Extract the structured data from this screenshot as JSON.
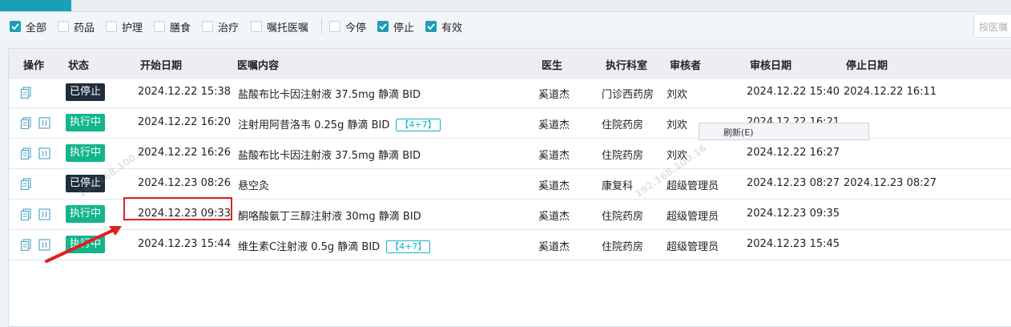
{
  "filters": [
    {
      "label": "全部",
      "checked": true
    },
    {
      "label": "药品",
      "checked": false
    },
    {
      "label": "护理",
      "checked": false
    },
    {
      "label": "膳食",
      "checked": false
    },
    {
      "label": "治疗",
      "checked": false
    },
    {
      "label": "嘱托医嘱",
      "checked": false
    },
    {
      "label": "今停",
      "checked": false
    },
    {
      "label": "停止",
      "checked": true
    },
    {
      "label": "有效",
      "checked": true
    }
  ],
  "search": {
    "placeholder": "按医嘱"
  },
  "columns": {
    "ops": "操作",
    "status": "状态",
    "start": "开始日期",
    "content": "医嘱内容",
    "doctor": "医生",
    "dept": "执行科室",
    "reviewer": "审核者",
    "review_date": "审核日期",
    "stop_date": "停止日期"
  },
  "rows": [
    {
      "status": "已停止",
      "start": "2024.12.22 15:38",
      "content": "盐酸布比卡因注射液 37.5mg 静滴 BID",
      "tag": "",
      "doctor": "奚道杰",
      "dept": "门诊西药房",
      "reviewer": "刘欢",
      "review_date": "2024.12.22 15:40",
      "stop_date": "2024.12.22 16:11"
    },
    {
      "status": "执行中",
      "start": "2024.12.22 16:20",
      "content": "注射用阿昔洛韦 0.25g 静滴 BID",
      "tag": "【4+7】",
      "doctor": "奚道杰",
      "dept": "住院药房",
      "reviewer": "刘欢",
      "review_date": "2024.12.22 16:21",
      "stop_date": ""
    },
    {
      "status": "执行中",
      "start": "2024.12.22 16:26",
      "content": "盐酸布比卡因注射液 37.5mg 静滴 BID",
      "tag": "",
      "doctor": "奚道杰",
      "dept": "住院药房",
      "reviewer": "刘欢",
      "review_date": "2024.12.22 16:27",
      "stop_date": ""
    },
    {
      "status": "已停止",
      "start": "2024.12.23 08:26",
      "content": "悬空灸",
      "tag": "",
      "doctor": "奚道杰",
      "dept": "康复科",
      "reviewer": "超级管理员",
      "review_date": "2024.12.23 08:27",
      "stop_date": "2024.12.23 08:27"
    },
    {
      "status": "执行中",
      "start": "2024.12.23 09:33",
      "content": "酮咯酸氨丁三醇注射液 30mg 静滴 BID",
      "tag": "",
      "doctor": "奚道杰",
      "dept": "住院药房",
      "reviewer": "超级管理员",
      "review_date": "2024.12.23 09:35",
      "stop_date": ""
    },
    {
      "status": "执行中",
      "start": "2024.12.23 15:44",
      "content": "维生素C注射液 0.5g 静滴 BID",
      "tag": "【4+7】",
      "doctor": "奚道杰",
      "dept": "住院药房",
      "reviewer": "超级管理员",
      "review_date": "2024.12.23 15:45",
      "stop_date": ""
    }
  ],
  "context_menu": {
    "refresh": "刷新(E)"
  },
  "watermark": "192.168.100.16",
  "colors": {
    "accent": "#1aa0b4",
    "running": "#13b58a",
    "stopped": "#1f2d3d",
    "highlight": "#e02020"
  },
  "icons": {
    "copy": "copy-icon",
    "pause": "pause-icon"
  }
}
